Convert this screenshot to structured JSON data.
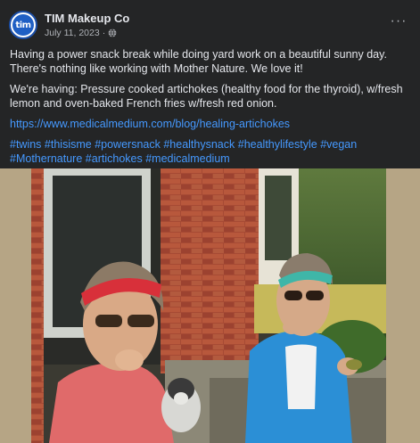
{
  "post": {
    "page_name": "TIM Makeup Co",
    "avatar_text": "tim",
    "date": "July 11, 2023",
    "separator": "·",
    "privacy_icon": "globe-icon",
    "more_label": "···",
    "paragraphs": [
      "Having a power snack break while doing yard work on a beautiful sunny day. There's nothing like working with Mother Nature. We love it!",
      "We're having: Pressure cooked artichokes (healthy food for the thyroid), w/fresh lemon and oven-baked French fries w/fresh red onion."
    ],
    "link": "https://www.medicalmedium.com/blog/healing-artichokes",
    "hashtags": [
      "#twins",
      "#thisisme",
      "#powersnack",
      "#healthysnack",
      "#healthylifestyle",
      "#vegan",
      "#Mothernature",
      "#artichokes",
      "#medicalmedium"
    ]
  },
  "colors": {
    "background": "#242526",
    "text": "#e4e6eb",
    "muted": "#b0b3b8",
    "link": "#4599ff",
    "photo_border": "#b6a585"
  }
}
